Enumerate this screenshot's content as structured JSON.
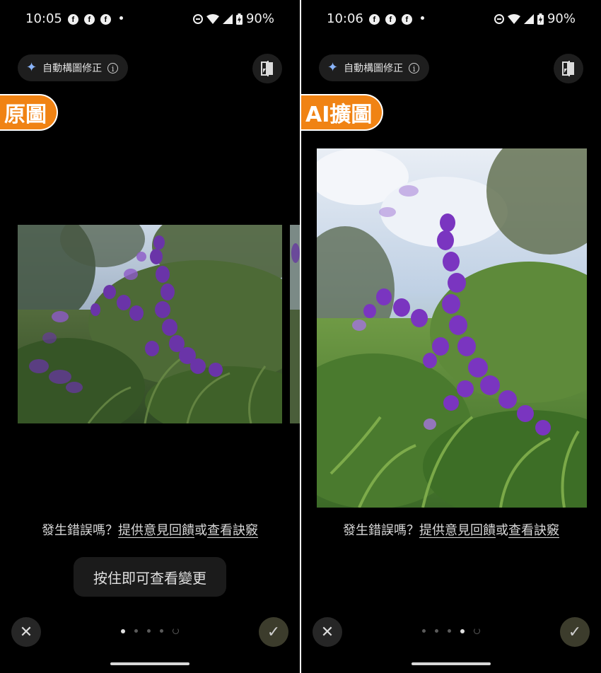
{
  "panels": [
    {
      "id": "left",
      "status": {
        "time": "10:05",
        "battery": "90%"
      },
      "chip_label": "自動構圖修正",
      "overlay_label": "原圖",
      "feedback": {
        "prefix": "發生錯誤嗎？",
        "link1": "提供意見回饋",
        "middle": "或",
        "link2": "查看訣竅"
      },
      "hold_button": "按住即可查看變更",
      "page_indicator": {
        "count": 4,
        "active_index": 0
      }
    },
    {
      "id": "right",
      "status": {
        "time": "10:06",
        "battery": "90%"
      },
      "chip_label": "自動構圖修正",
      "overlay_label": "AI擴圖",
      "feedback": {
        "prefix": "發生錯誤嗎？",
        "link1": "提供意見回饋",
        "middle": "或",
        "link2": "查看訣竅"
      },
      "page_indicator": {
        "count": 4,
        "active_index": 3
      }
    }
  ],
  "icons": {
    "sparkle": "sparkle-icon",
    "info": "info-icon",
    "compare": "compare-icon",
    "close": "close-icon",
    "check": "check-icon"
  },
  "colors": {
    "label_orange": "#f08314",
    "background": "#000000",
    "sparkle_blue": "#8ab4f8",
    "flower_purple": "#6a2fb0",
    "foliage_green": "#4b7a34"
  }
}
